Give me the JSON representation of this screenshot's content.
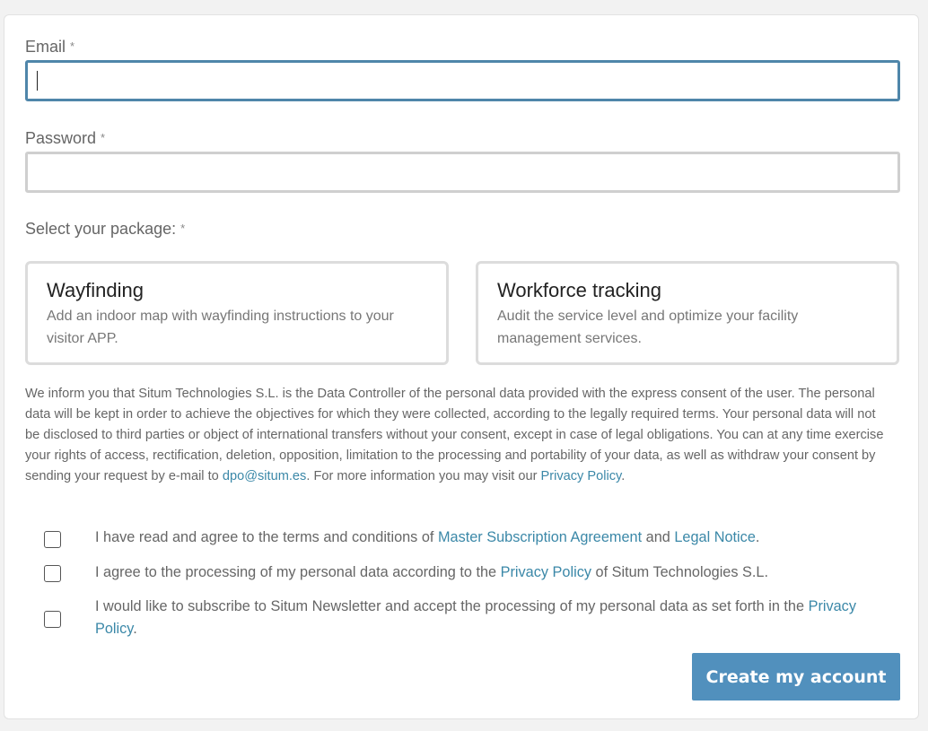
{
  "form": {
    "email_label": "Email",
    "password_label": "Password",
    "required_mark": "*",
    "email_value": "",
    "password_value": "",
    "package_label": "Select your package:"
  },
  "packages": [
    {
      "title": "Wayfinding",
      "description": "Add an indoor map with wayfinding instructions to your visitor APP."
    },
    {
      "title": "Workforce tracking",
      "description": "Audit the service level and optimize your facility management services."
    }
  ],
  "legal": {
    "text_before_email": "We inform you that Situm Technologies S.L. is the Data Controller of the personal data provided with the express consent of the user. The personal data will be kept in order to achieve the objectives for which they were collected, according to the legally required terms. Your personal data will not be disclosed to third parties or object of international transfers without your consent, except in case of legal obligations. You can at any time exercise your rights of access, rectification, deletion, opposition, limitation to the processing and portability of your data, as well as withdraw your consent by sending your request by e-mail to",
    "email_link": "dpo@situm.es",
    "text_after_email": ". For more information you may visit our",
    "privacy_link": "Privacy Policy",
    "end_period": "."
  },
  "checkboxes": {
    "terms": {
      "text_start": "I have read and agree to the terms and conditions of",
      "link1": "Master Subscription Agreement",
      "text_middle": "and",
      "link2": "Legal Notice",
      "text_end": ".",
      "checked": false
    },
    "processing": {
      "text_start": "I agree to the processing of my personal data according to the",
      "link": "Privacy Policy",
      "text_end": "of Situm Technologies S.L.",
      "checked": false
    },
    "newsletter": {
      "text_start": "I would like to subscribe to Situm Newsletter and accept the processing of my personal data as set forth in the",
      "link": "Privacy Policy",
      "text_end": ".",
      "checked": false
    }
  },
  "submit_label": "Create my account",
  "colors": {
    "accent": "#5190bd",
    "link": "#3b88a8",
    "focus_border": "#4f86aa"
  }
}
